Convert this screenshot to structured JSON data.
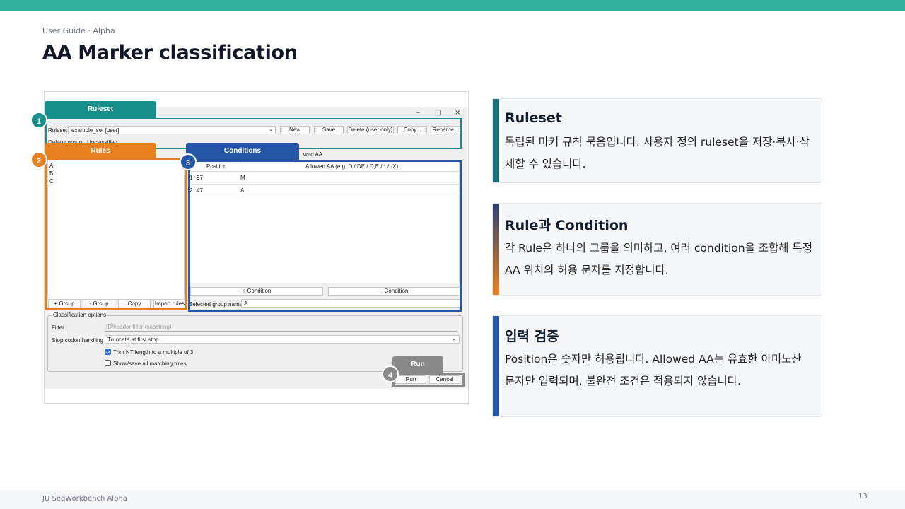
{
  "header": {
    "subtitle": "User Guide · Alpha",
    "title": "AA Marker classification"
  },
  "footer": {
    "text": "JU SeqWorkbench Alpha",
    "page": "13"
  },
  "app": {
    "window_controls": [
      "–",
      "□",
      "×"
    ],
    "ruleset_label": "Ruleset:",
    "ruleset_value": "example_set [user]",
    "ruleset_buttons": [
      "New",
      "Save",
      "Delete (user only)",
      "Copy...",
      "Rename..."
    ],
    "default_group_label": "Default group:",
    "default_group_value": "Unclassified",
    "rules_items": [
      "A",
      "B",
      "C"
    ],
    "rules_buttons": [
      "+ Group",
      "- Group",
      "Copy",
      "Import rules"
    ],
    "allowed_header_stub": "wed AA",
    "conditions_headers": [
      "Position",
      "Allowed AA (e.g. D / DE / D,E / * / -X)"
    ],
    "conditions_rows": [
      {
        "index": "1",
        "position": "97",
        "allowed": "M"
      },
      {
        "index": "2",
        "position": "47",
        "allowed": "A"
      }
    ],
    "conditions_buttons": [
      "+ Condition",
      "- Condition"
    ],
    "group_name_label": "Selected group name:",
    "group_name_value": "A",
    "options_title": "Classification options",
    "filter_label": "Filter",
    "filter_placeholder": "ID/header filter (substring)",
    "stop_label": "Stop codon handling",
    "stop_value": "Truncate at first stop",
    "trim_label": "Trim NT length to a multiple of 3",
    "trim_checked": true,
    "show_label": "Show/save all matching rules",
    "show_checked": false,
    "run_button": "Run",
    "cancel_button": "Cancel"
  },
  "callouts": [
    {
      "num": "1",
      "label": "Ruleset",
      "color": "#178f8a"
    },
    {
      "num": "2",
      "label": "Rules",
      "color": "#e8801f"
    },
    {
      "num": "3",
      "label": "Conditions",
      "color": "#2656a6"
    },
    {
      "num": "4",
      "label": "Run",
      "color": "#8a8a8a"
    }
  ],
  "cards": [
    {
      "title": "Ruleset",
      "body": "독립된 마커 규칙 묶음입니다. 사용자 정의 ruleset을 저장·복사·삭제할 수 있습니다.",
      "accent": "#1a6f78"
    },
    {
      "title": "Rule과 Condition",
      "body": "각 Rule은 하나의 그룹을 의미하고, 여러 condition을 조합해 특정 AA 위치의 허용 문자를 지정합니다.",
      "accent_top": "#2a3f6e",
      "accent_bottom": "#e8801f"
    },
    {
      "title": "입력 검증",
      "body": "Position은 숫자만 허용됩니다. Allowed AA는 유효한 아미노산 문자만 입력되며, 불완전 조건은 적용되지 않습니다.",
      "accent": "#2656a6"
    }
  ],
  "colors": {
    "top_bar": "#34b29f",
    "ruleset": "#178f8a",
    "rules": "#e8801f",
    "conditions": "#2656a6",
    "run": "#8a8a8a"
  }
}
